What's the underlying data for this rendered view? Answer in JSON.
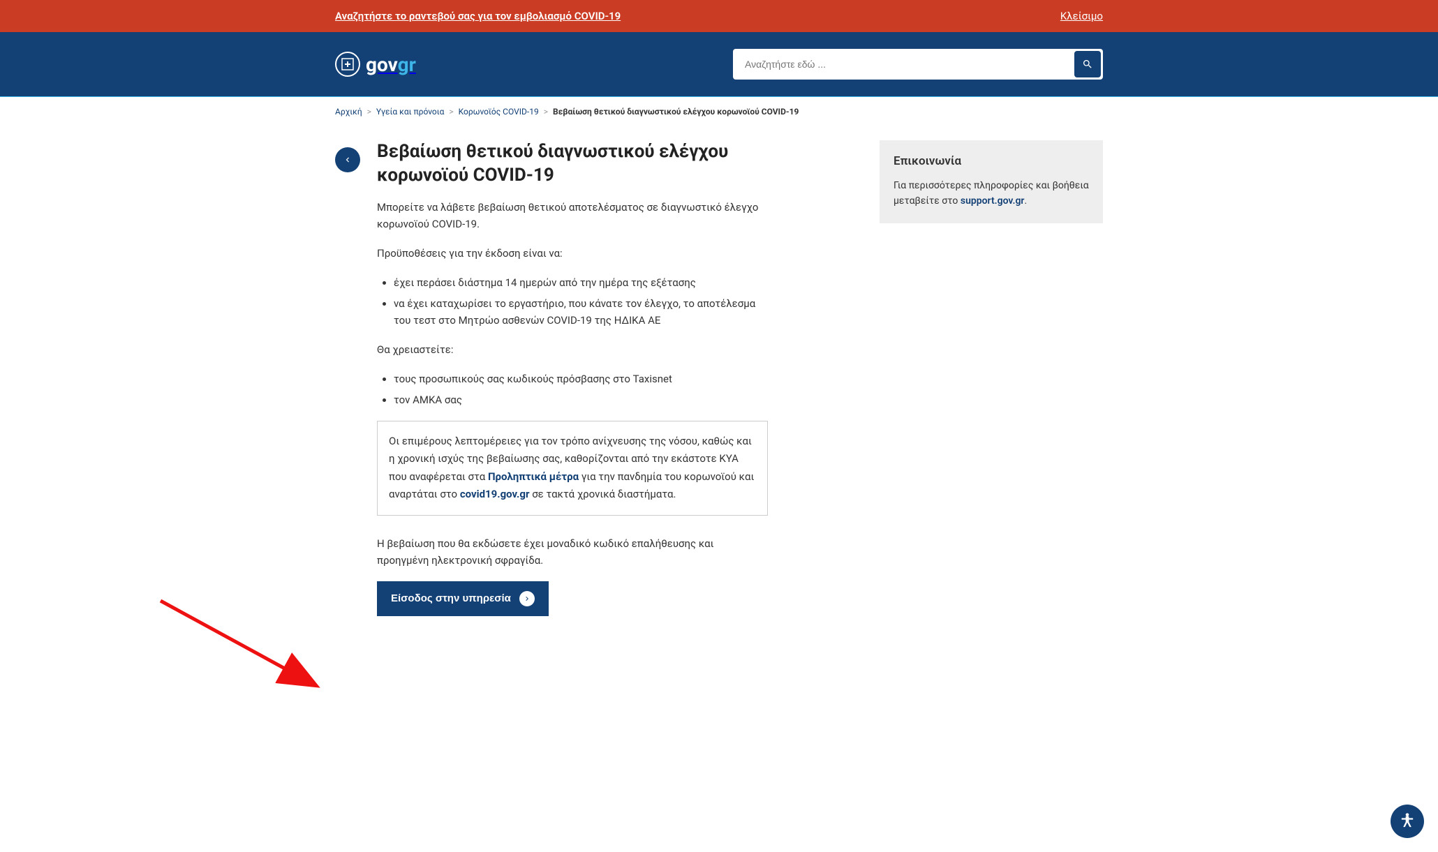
{
  "alert": {
    "message": "Αναζητήστε το ραντεβού σας για τον εμβολιασμό COVID-19",
    "close_label": "Κλείσιμο"
  },
  "logo": {
    "text_gov": "gov",
    "text_gr": "gr"
  },
  "search": {
    "placeholder": "Αναζητήστε εδώ ..."
  },
  "breadcrumb": {
    "items": [
      {
        "label": "Αρχική"
      },
      {
        "label": "Υγεία και πρόνοια"
      },
      {
        "label": "Κορωνοϊός COVID-19"
      }
    ],
    "current": "Βεβαίωση θετικού διαγνωστικού ελέγχου κορωνοϊού COVID-19"
  },
  "article": {
    "title": "Βεβαίωση θετικού διαγνωστικού ελέγχου κορωνοϊού COVID-19",
    "intro": "Μπορείτε να λάβετε βεβαίωση θετικού αποτελέσματος σε διαγνωστικό έλεγχο κορωνοϊού COVID-19.",
    "prereq_heading": "Προϋποθέσεις για την έκδοση είναι να:",
    "prereq_items": [
      "έχει περάσει διάστημα 14 ημερών από την ημέρα της εξέτασης",
      "να έχει καταχωρίσει το εργαστήριο, που κάνατε τον έλεγχο, το αποτέλεσμα του τεστ στο Μητρώο ασθενών COVID-19 της ΗΔΙΚΑ ΑΕ"
    ],
    "need_heading": "Θα χρειαστείτε:",
    "need_items": [
      "τους προσωπικούς σας κωδικούς πρόσβασης στο Taxisnet",
      "τον ΑΜΚΑ σας"
    ],
    "info_box": {
      "text_before": "Οι επιμέρους λεπτομέρειες για τον τρόπο ανίχνευσης της νόσου, καθώς και η χρονική ισχύς της βεβαίωσης σας, καθορίζονται από την εκάστοτε ΚΥΑ που αναφέρεται στα ",
      "link1": "Προληπτικά μέτρα",
      "text_middle": " για την πανδημία του κορωνοϊού και αναρτάται στο ",
      "link2": "covid19.gov.gr",
      "text_after": " σε τακτά χρονικά διαστήματα."
    },
    "note": "Η βεβαίωση που θα εκδώσετε έχει μοναδικό κωδικό επαλήθευσης και προηγμένη ηλεκτρονική σφραγίδα.",
    "cta_label": "Είσοδος στην υπηρεσία"
  },
  "sidebar": {
    "contact_title": "Επικοινωνία",
    "contact_text_before": "Για περισσότερες πληροφορίες και βοήθεια μεταβείτε στο ",
    "contact_link": "support.gov.gr",
    "contact_text_after": "."
  }
}
